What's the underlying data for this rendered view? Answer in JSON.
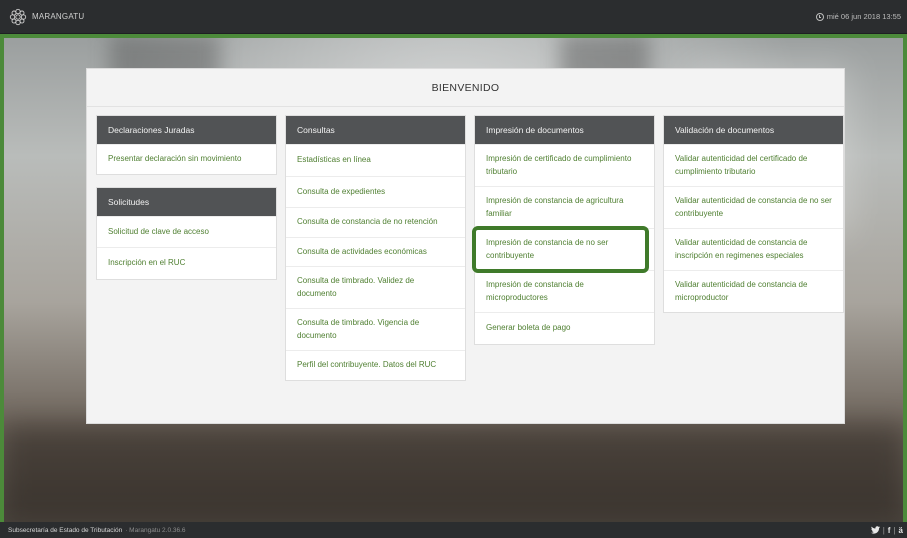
{
  "header": {
    "brand": "MARANGATU",
    "datetime": "mié 06 jun 2018 13:55"
  },
  "panel": {
    "title": "BIENVENIDO"
  },
  "columns": {
    "declaraciones": {
      "title": "Declaraciones Juradas",
      "items": [
        "Presentar declaración sin movimiento"
      ]
    },
    "solicitudes": {
      "title": "Solicitudes",
      "items": [
        "Solicitud de clave de acceso",
        "Inscripción en el RUC"
      ]
    },
    "consultas": {
      "title": "Consultas",
      "items": [
        "Estadísticas en línea",
        "Consulta de expedientes",
        "Consulta de constancia de no retención",
        "Consulta de actividades económicas",
        "Consulta de timbrado. Validez de documento",
        "Consulta de timbrado. Vigencia de documento",
        "Perfil del contribuyente. Datos del RUC"
      ]
    },
    "impresion": {
      "title": "Impresión de documentos",
      "items": [
        "Impresión de certificado de cumplimiento tributario",
        "Impresión de constancia de agricultura familiar",
        "Impresión de constancia de no ser contribuyente",
        "Impresión de constancia de microproductores",
        "Generar boleta de pago"
      ]
    },
    "validacion": {
      "title": "Validación de documentos",
      "items": [
        "Validar autenticidad del certificado de cumplimiento tributario",
        "Validar autenticidad de constancia de no ser contribuyente",
        "Validar autenticidad de constancia de inscripción en regimenes especiales",
        "Validar autenticidad de constancia de microproductor"
      ]
    }
  },
  "footer": {
    "org": "Subsecretaría de Estado de Tributación",
    "version": "· Marangatu 2.0.36.6",
    "social_twitter": "🐦",
    "social_facebook": "f"
  },
  "colors": {
    "accent_green": "#4f7f31",
    "highlight_green": "#3f7a2a",
    "card_header": "#515355"
  }
}
